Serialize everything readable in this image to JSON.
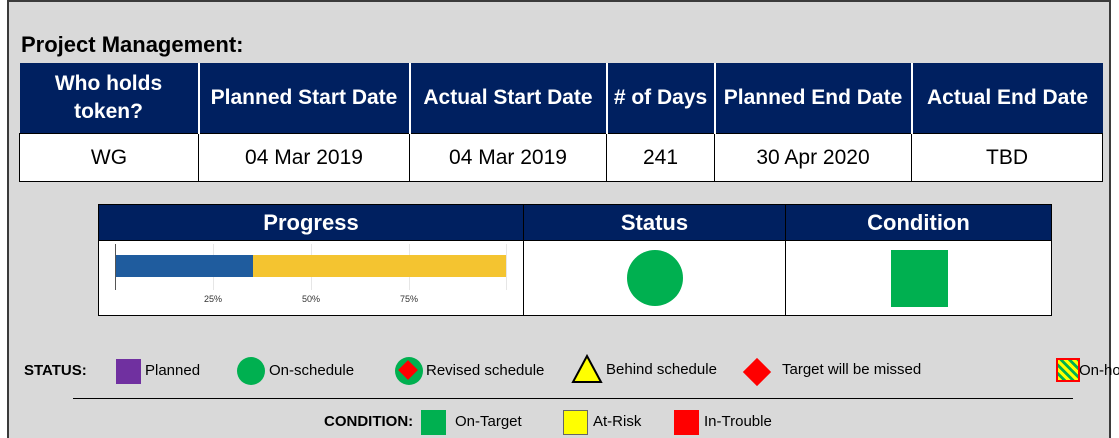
{
  "title": "Project Management:",
  "info": {
    "headers": [
      "Who holds token?",
      "Planned Start Date",
      "Actual Start Date",
      "# of Days",
      "Planned End Date",
      "Actual End Date"
    ],
    "values": [
      "WG",
      "04 Mar 2019",
      "04 Mar 2019",
      "241",
      "30 Apr 2020",
      "TBD"
    ]
  },
  "summary": {
    "progress_label": "Progress",
    "status_label": "Status",
    "condition_label": "Condition",
    "progress_percent": 35,
    "ticks": [
      "25%",
      "50%",
      "75%"
    ],
    "status_color": "#00b050",
    "condition_color": "#00b050"
  },
  "legend": {
    "status_title": "STATUS:",
    "status_items": [
      "Planned",
      "On-schedule",
      "Revised schedule",
      "Behind schedule",
      "Target will be missed",
      "On-hold"
    ],
    "condition_title": "CONDITION:",
    "condition_items": [
      "On-Target",
      "At-Risk",
      "In-Trouble"
    ]
  },
  "colors": {
    "header": "#002060",
    "planned": "#7030a0",
    "on_schedule": "#00b050",
    "target_missed": "#ff0000",
    "behind": "#ffff00",
    "at_risk": "#ffff00",
    "in_trouble": "#ff0000",
    "progress_done": "#1f5c9e",
    "progress_remaining": "#f4c430"
  }
}
